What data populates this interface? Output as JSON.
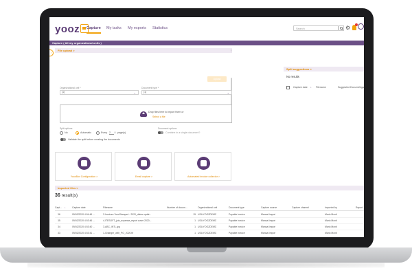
{
  "brand": {
    "logo_text": "yooz",
    "accent": "#f2a20c",
    "primary": "#5b3c75"
  },
  "nav": {
    "items": [
      "Capture",
      "My tasks",
      "My exports",
      "Statistics"
    ],
    "active": "Capture"
  },
  "header": {
    "search_placeholder": "Search",
    "icons": [
      "search-icon",
      "gear-icon",
      "bell-icon",
      "user-icon"
    ]
  },
  "breadcrumb": "Capture ( All my organizational units )",
  "file_upload": {
    "title": "File upload  >",
    "org_unit_label": "Organizational unit *",
    "org_unit_value": "(1)",
    "doc_type_label": "Document type *",
    "doc_type_value": "(1)",
    "upload_button": "Upload",
    "drop_text": "Drop files here to import them or",
    "drop_link": "Select a file",
    "split_label": "Split options",
    "split_no": "No",
    "split_auto": "Automatic",
    "split_every": "Every",
    "split_every_value": "2",
    "split_page": "page(s)",
    "validate_label": "Validate the split before creating the documents",
    "doc_options_label": "Document options",
    "combine_label": "Combine in a single document?"
  },
  "split_suggestions": {
    "title": "Split suggestions  >",
    "no_results": "No results",
    "columns": [
      "Capture date",
      "Filename",
      "Suggested Docum...",
      "Orga"
    ]
  },
  "tiles": [
    {
      "label": "YoozBox Configuration  >",
      "icon": "printer-icon"
    },
    {
      "label": "Email capture  >",
      "icon": "email-icon"
    },
    {
      "label": "Automated invoice collector  >",
      "icon": "cloud-upload-icon"
    }
  ],
  "imported": {
    "title": "Imported files  >",
    "count": "36",
    "count_suffix": "result(s)",
    "columns": [
      "Capt...",
      "Capture date",
      "Filename",
      "Number of docum...",
      "Organizational unit",
      "Document type",
      "Capture source",
      "Capture channel",
      "Imported by",
      "Report"
    ],
    "rows": [
      [
        "36",
        "09/02/2020 4:54:46 ...",
        "2-Invoices YoozStamped - 2020_dates updat...",
        "15",
        "USA YOOZDEMO",
        "Payable invoice",
        "Manual import",
        "",
        "Mario Monti",
        ""
      ],
      [
        "35",
        "09/02/2020 4:53:46 ...",
        "4-ITESOFT_join_expense_report cover 2020...",
        "1",
        "USA YOOZDEMO",
        "Payable invoice",
        "Manual import",
        "",
        "Mario Monti",
        ""
      ],
      [
        "34",
        "09/02/2020 4:53:40 ...",
        "3-ABC_INTL.jpg",
        "1",
        "USA YOOZDEMO",
        "Payable invoice",
        "Manual import",
        "",
        "Mario Monti",
        ""
      ],
      [
        "33",
        "09/02/2020 4:53:41 ...",
        "1-Grainger_with_PO_2020.tif",
        "1",
        "USA YOOZDEMO",
        "Payable invoice",
        "Manual import",
        "",
        "Mario Monti",
        ""
      ]
    ]
  }
}
